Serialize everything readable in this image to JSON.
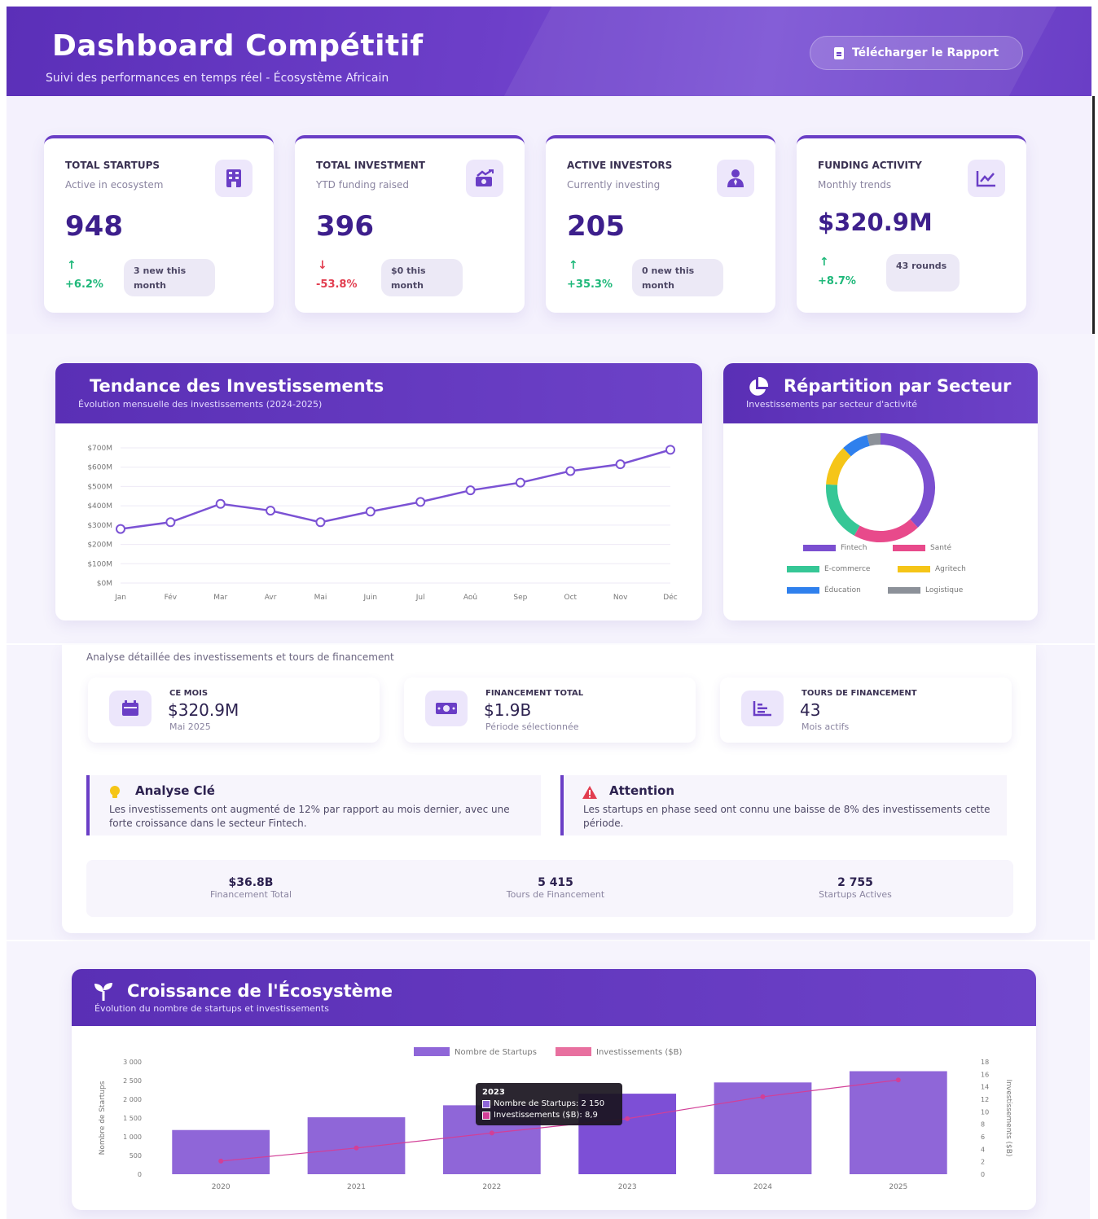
{
  "header": {
    "title": "Dashboard Compétitif",
    "subtitle": "Suivi des performances en temps réel - Écosystème Africain",
    "download_label": "Télécharger le Rapport"
  },
  "kpis": [
    {
      "title": "TOTAL STARTUPS",
      "desc": "Active in ecosystem",
      "value": "948",
      "arrow": "↑",
      "change": "+6.2%",
      "note": "3 new this month",
      "trend": "up",
      "icon": "building-icon"
    },
    {
      "title": "TOTAL INVESTMENT",
      "desc": "YTD funding raised",
      "value": "396",
      "arrow": "↓",
      "change": "-53.8%",
      "note": "$0 this month",
      "trend": "down",
      "icon": "money-hand-icon"
    },
    {
      "title": "ACTIVE INVESTORS",
      "desc": "Currently investing",
      "value": "205",
      "arrow": "↑",
      "change": "+35.3%",
      "note": "0 new this month",
      "trend": "up",
      "icon": "user-tie-icon"
    },
    {
      "title": "FUNDING ACTIVITY",
      "desc": "Monthly trends",
      "value": "$320.9M",
      "arrow": "↑",
      "change": "+8.7%",
      "note": "43 rounds",
      "trend": "up",
      "icon": "line-chart-icon"
    }
  ],
  "trend_card": {
    "title": "Tendance des Investissements",
    "subtitle": "Évolution mensuelle des investissements (2024-2025)"
  },
  "sector_card": {
    "title": "Répartition par Secteur",
    "subtitle": "Investissements par secteur d'activité",
    "legend": [
      {
        "label": "Fintech",
        "color": "#7b4fd0"
      },
      {
        "label": "Santé",
        "color": "#e84a8b"
      },
      {
        "label": "E-commerce",
        "color": "#36c796"
      },
      {
        "label": "Agritech",
        "color": "#f5c518"
      },
      {
        "label": "Éducation",
        "color": "#2f80ed"
      },
      {
        "label": "Logistique",
        "color": "#8c9199"
      }
    ]
  },
  "analysis": {
    "intro": "Analyse détaillée des investissements et tours de financement",
    "stats": [
      {
        "label": "CE MOIS",
        "value": "$320.9M",
        "sub": "Mai 2025",
        "icon": "calendar-icon"
      },
      {
        "label": "FINANCEMENT TOTAL",
        "value": "$1.9B",
        "sub": "Période sélectionnée",
        "icon": "money-bill-icon"
      },
      {
        "label": "TOURS DE FINANCEMENT",
        "value": "43",
        "sub": "Mois actifs",
        "icon": "bar-list-icon"
      }
    ],
    "insights": [
      {
        "title": "Analyse Clé",
        "text": "Les investissements ont augmenté de 12% par rapport au mois dernier, avec une forte croissance dans le secteur Fintech."
      },
      {
        "title": "Attention",
        "text": "Les startups en phase seed ont connu une baisse de 8% des investissements cette période."
      }
    ],
    "totals": [
      {
        "value": "$36.8B",
        "label": "Financement Total"
      },
      {
        "value": "5 415",
        "label": "Tours de Financement"
      },
      {
        "value": "2 755",
        "label": "Startups Actives"
      }
    ]
  },
  "growth_card": {
    "title": "Croissance de l'Écosystème",
    "subtitle": "Évolution du nombre de startups et investissements",
    "tooltip": {
      "title": "2023",
      "line1": "Nombre de Startups: 2 150",
      "line2": "Investissements ($B): 8,9"
    }
  },
  "chart_data": [
    {
      "type": "line",
      "x": [
        "Jan",
        "Fév",
        "Mar",
        "Avr",
        "Mai",
        "Juin",
        "Jul",
        "Aoû",
        "Sep",
        "Oct",
        "Nov",
        "Déc"
      ],
      "series": [
        {
          "values": [
            280,
            315,
            410,
            375,
            315,
            370,
            420,
            480,
            520,
            580,
            615,
            690
          ]
        }
      ],
      "y_ticks": [
        "$0M",
        "$100M",
        "$200M",
        "$300M",
        "$400M",
        "$500M",
        "$600M",
        "$700M"
      ],
      "ylim": [
        0,
        700
      ],
      "color": "#7b52d4",
      "grid": true
    },
    {
      "type": "pie",
      "donut": true,
      "categories": [
        "Fintech",
        "Santé",
        "E-commerce",
        "Agritech",
        "Éducation",
        "Logistique"
      ],
      "values": [
        38,
        20,
        18,
        12,
        8,
        4
      ]
    },
    {
      "type": "bar",
      "categories": [
        "2020",
        "2021",
        "2022",
        "2023",
        "2024",
        "2025"
      ],
      "series": [
        {
          "name": "Nombre de Startups",
          "values": [
            1180,
            1520,
            1840,
            2150,
            2450,
            2750
          ],
          "color": "#8f66d8",
          "axis": "left"
        },
        {
          "name": "Investissements ($B)",
          "values": [
            2.1,
            4.2,
            6.6,
            8.9,
            12.4,
            15.1
          ],
          "color": "#d23f97",
          "axis": "right",
          "render": "line"
        }
      ],
      "ylabel": "Nombre de Startups",
      "y2label": "Investissements ($B)",
      "ylim": [
        0,
        3000
      ],
      "y2lim": [
        0,
        18
      ],
      "y_ticks": [
        "0",
        "500",
        "1 000",
        "1 500",
        "2 000",
        "2 500",
        "3 000"
      ],
      "y2_ticks": [
        "0",
        "2",
        "4",
        "6",
        "8",
        "10",
        "12",
        "14",
        "16",
        "18"
      ],
      "legend": "top"
    }
  ]
}
